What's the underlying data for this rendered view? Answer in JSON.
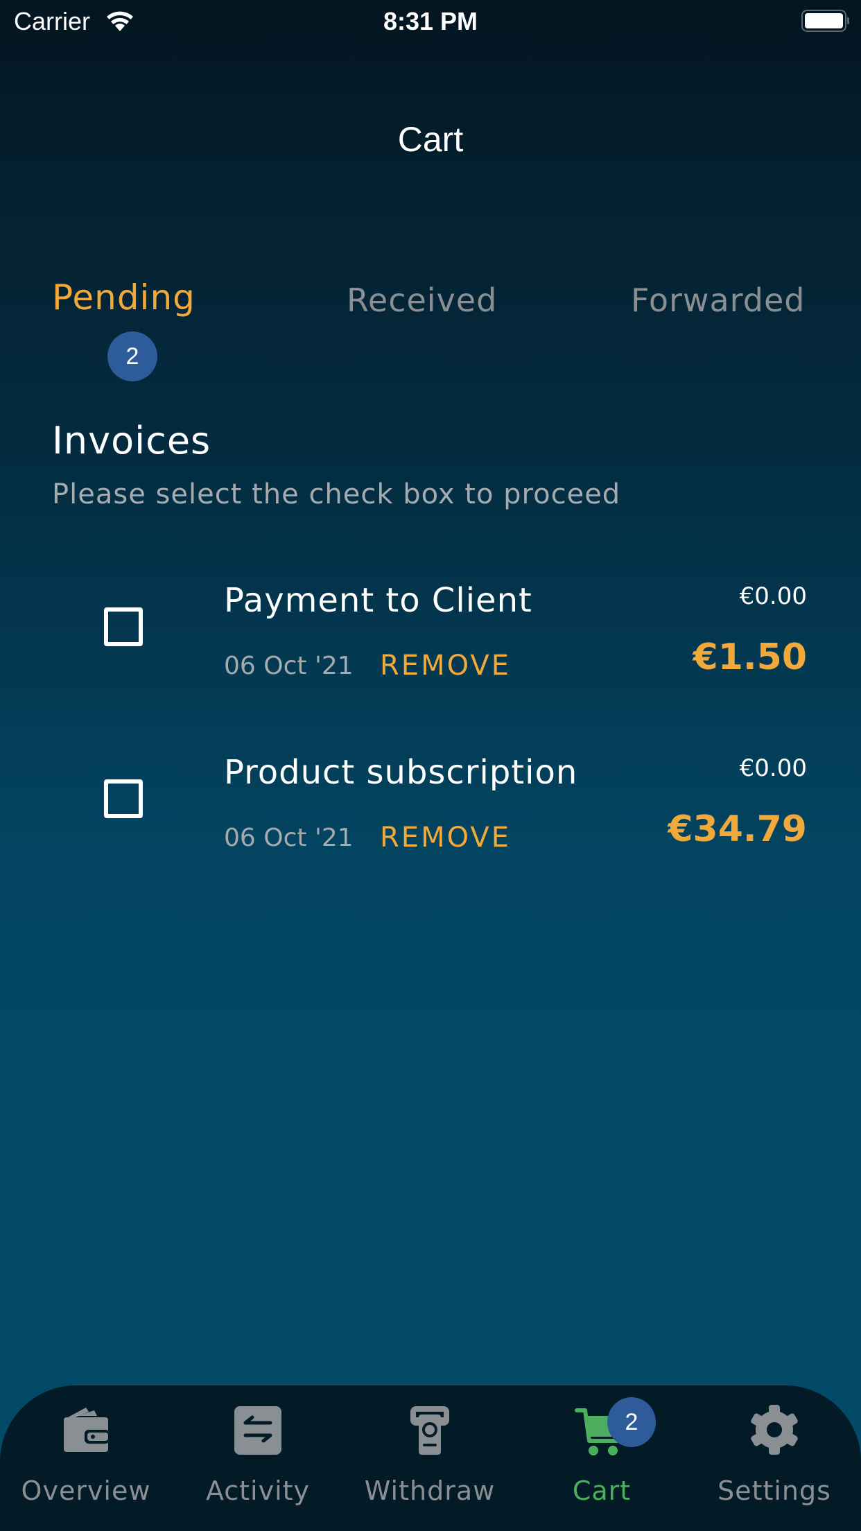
{
  "status_bar": {
    "carrier": "Carrier",
    "time": "8:31 PM",
    "wifi_icon": "wifi-icon",
    "battery_icon": "battery-full-icon"
  },
  "header": {
    "title": "Cart"
  },
  "tabs": [
    {
      "label": "Pending",
      "active": true,
      "badge": "2"
    },
    {
      "label": "Received",
      "active": false
    },
    {
      "label": "Forwarded",
      "active": false
    }
  ],
  "section": {
    "title": "Invoices",
    "subtitle": "Please select the check box to proceed"
  },
  "invoices": [
    {
      "name": "Payment to Client",
      "date": "06 Oct '21",
      "remove_label": "REMOVE",
      "amount_small": "€0.00",
      "amount_large": "€1.50",
      "checked": false
    },
    {
      "name": "Product subscription",
      "date": "06 Oct '21",
      "remove_label": "REMOVE",
      "amount_small": "€0.00",
      "amount_large": "€34.79",
      "checked": false
    }
  ],
  "bottom_nav": {
    "items": [
      {
        "label": "Overview",
        "icon": "wallet-icon",
        "active": false
      },
      {
        "label": "Activity",
        "icon": "transfer-arrows-icon",
        "active": false
      },
      {
        "label": "Withdraw",
        "icon": "atm-cash-icon",
        "active": false
      },
      {
        "label": "Cart",
        "icon": "cart-icon",
        "active": true,
        "badge": "2"
      },
      {
        "label": "Settings",
        "icon": "gear-icon",
        "active": false
      }
    ]
  },
  "colors": {
    "accent_orange": "#f0a93a",
    "active_green": "#4caf5f",
    "badge_blue": "#2e5b9a",
    "inactive_gray": "#8a8f93",
    "nav_background": "#031a27"
  }
}
